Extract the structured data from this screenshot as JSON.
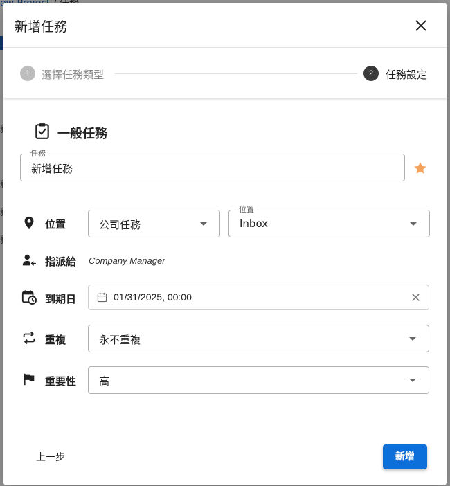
{
  "background": {
    "breadcrumb_project": "ew Project",
    "breadcrumb_sep": " / ",
    "breadcrumb_current": "任務",
    "side_fragment": "務"
  },
  "dialog": {
    "title": "新增任務"
  },
  "stepper": {
    "steps": [
      {
        "number": "1",
        "label": "選擇任務類型",
        "state": "completed"
      },
      {
        "number": "2",
        "label": "任務設定",
        "state": "active"
      }
    ]
  },
  "section": {
    "title": "一般任務",
    "icon": "clipboard-check-icon"
  },
  "task_field": {
    "legend": "任務",
    "value": "新增任務",
    "favorite_icon": "star-icon",
    "favorite_color": "#f5a25d"
  },
  "location": {
    "label": "位置",
    "icon": "map-pin-icon",
    "select_value": "公司任務",
    "position_legend": "位置",
    "position_value": "Inbox"
  },
  "assign": {
    "label": "指派給",
    "icon": "user-assign-icon",
    "value": "Company Manager"
  },
  "due": {
    "label": "到期日",
    "icon": "calendar-clock-icon",
    "value": "01/31/2025, 00:00"
  },
  "repeat": {
    "label": "重複",
    "icon": "repeat-icon",
    "value": "永不重複"
  },
  "priority": {
    "label": "重要性",
    "icon": "flag-icon",
    "value": "高"
  },
  "footer": {
    "back_label": "上一步",
    "add_label": "新增",
    "add_color": "#0d6fd9"
  }
}
